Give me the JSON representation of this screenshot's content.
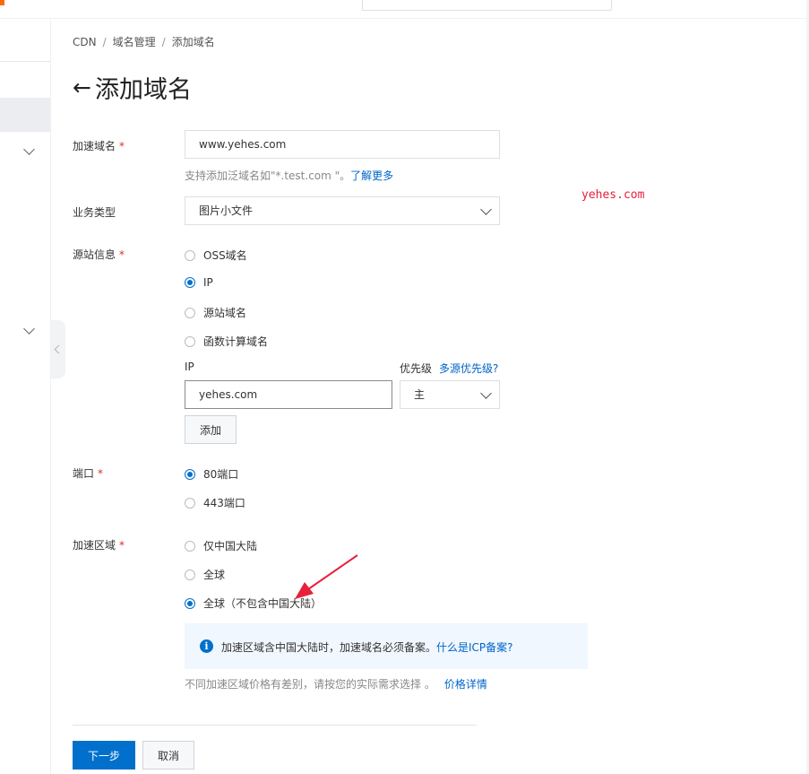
{
  "breadcrumb": {
    "items": [
      "CDN",
      "域名管理",
      "添加域名"
    ],
    "separator": "/"
  },
  "title": {
    "arrow": "←",
    "text": "添加域名"
  },
  "fields": {
    "domain": {
      "label": "加速域名",
      "required": "*",
      "value": "www.yehes.com",
      "help": "支持添加泛域名如\"*.test.com \"。",
      "help_link": "了解更多"
    },
    "business": {
      "label": "业务类型",
      "value": "图片小文件"
    },
    "origin": {
      "label": "源站信息",
      "required": "*",
      "options": [
        "OSS域名",
        "IP",
        "源站域名",
        "函数计算域名"
      ],
      "selected": "IP",
      "ip_label": "IP",
      "ip_value": "yehes.com",
      "priority_label": "优先级",
      "priority_link": "多源优先级?",
      "priority_value": "主",
      "add_button": "添加"
    },
    "port": {
      "label": "端口",
      "required": "*",
      "options": [
        "80端口",
        "443端口"
      ],
      "selected": "80端口"
    },
    "region": {
      "label": "加速区域",
      "required": "*",
      "options": [
        "仅中国大陆",
        "全球",
        "全球（不包含中国大陆）"
      ],
      "selected": "全球（不包含中国大陆）",
      "notice": "加速区域含中国大陆时，加速域名必须备案。",
      "notice_link": "什么是ICP备案?",
      "price_help": "不同加速区域价格有差别，请按您的实际需求选择 。",
      "price_link": "价格详情"
    }
  },
  "actions": {
    "next": "下一步",
    "cancel": "取消"
  },
  "watermark": "yehes.com",
  "colors": {
    "primary": "#0070cc",
    "link": "#0064c8",
    "required": "#d93026",
    "annotation_arrow": "#e8203a",
    "notice_bg": "#f0f7ff"
  }
}
